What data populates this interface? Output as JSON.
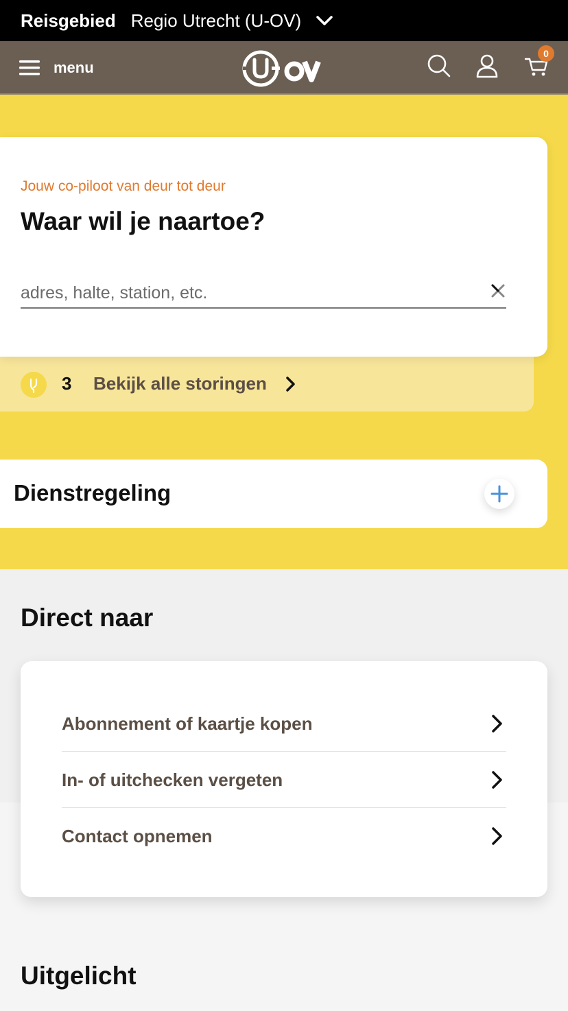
{
  "region": {
    "label": "Reisgebied",
    "value": "Regio Utrecht (U-OV)"
  },
  "header": {
    "menu_label": "menu",
    "logo_alt": "U-OV",
    "cart_count": "0"
  },
  "search": {
    "subtitle": "Jouw co-piloot van deur tot deur",
    "title": "Waar wil je naartoe?",
    "placeholder": "adres, halte, station, etc."
  },
  "disruptions": {
    "count": "3",
    "link": "Bekijk alle storingen"
  },
  "timetable": {
    "title": "Dienstregeling"
  },
  "direct": {
    "title": "Direct naar",
    "items": [
      {
        "label": "Abonnement of kaartje kopen"
      },
      {
        "label": "In- of uitchecken vergeten"
      },
      {
        "label": "Contact opnemen"
      }
    ]
  },
  "featured": {
    "title": "Uitgelicht"
  },
  "colors": {
    "brand": "#6b5f54",
    "accent_yellow": "#f5d94a",
    "accent_orange": "#e07a2e"
  },
  "icons": [
    "chevron-down-icon",
    "hamburger-icon",
    "search-icon",
    "user-icon",
    "cart-icon",
    "close-icon",
    "disruption-icon",
    "chevron-right-icon",
    "plus-icon"
  ]
}
